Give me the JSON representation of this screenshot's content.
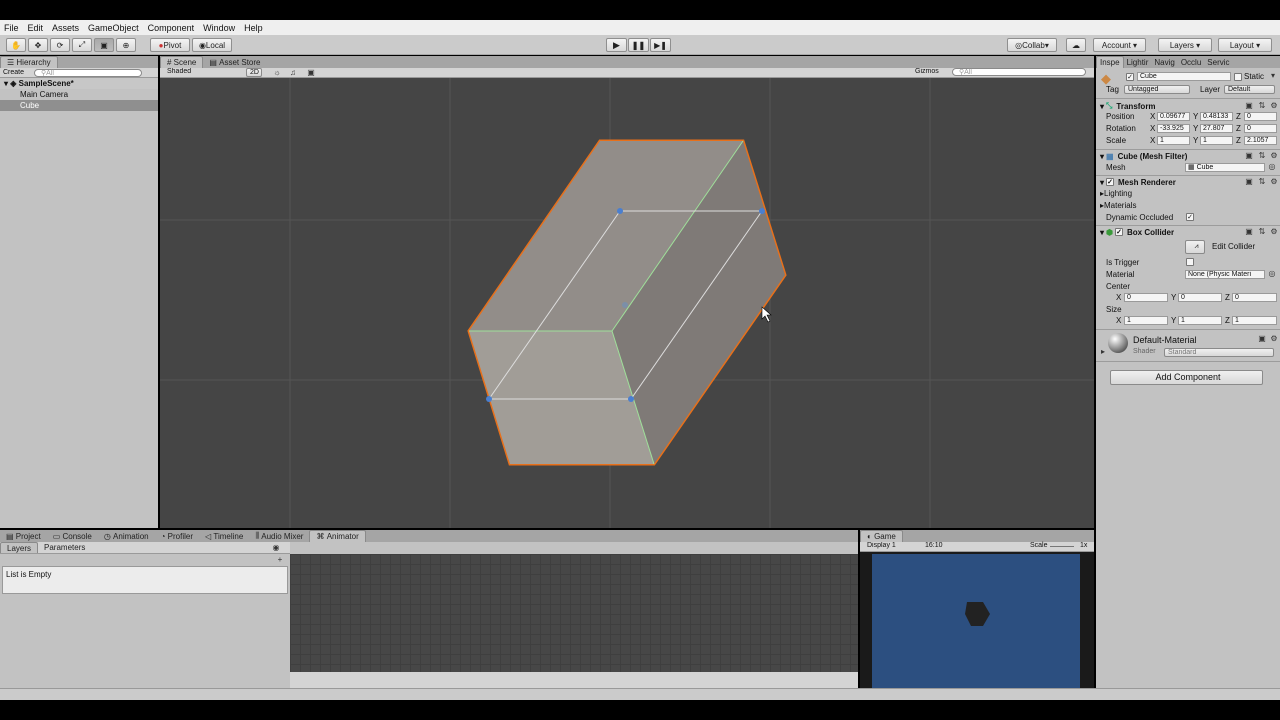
{
  "menu": [
    "File",
    "Edit",
    "Assets",
    "GameObject",
    "Component",
    "Window",
    "Help"
  ],
  "toolbar": {
    "pivot": "Pivot",
    "local": "Local",
    "collab": "Collab",
    "account": "Account",
    "layers": "Layers",
    "layout": "Layout"
  },
  "hierarchy": {
    "tab": "Hierarchy",
    "create": "Create",
    "search_placeholder": "All",
    "scene": "SampleScene*",
    "items": [
      "Main Camera",
      "Cube"
    ]
  },
  "scene": {
    "tab": "Scene",
    "asset_store_tab": "Asset Store",
    "shading": "Shaded",
    "mode2d": "2D",
    "gizmos": "Gizmos",
    "search_placeholder": "All"
  },
  "inspector": {
    "tabs": [
      "Inspe",
      "Lightir",
      "Navig",
      "Occlu",
      "Servic"
    ],
    "object_name": "Cube",
    "static_label": "Static",
    "tag_label": "Tag",
    "tag_value": "Untagged",
    "layer_label": "Layer",
    "layer_value": "Default",
    "transform": {
      "title": "Transform",
      "position_label": "Position",
      "rotation_label": "Rotation",
      "scale_label": "Scale",
      "position": [
        "0.09677",
        "0.48133",
        "0"
      ],
      "rotation": [
        "-33.925",
        "27.807",
        "0"
      ],
      "scale": [
        "1",
        "1",
        "2.1057"
      ]
    },
    "mesh_filter": {
      "title": "Cube (Mesh Filter)",
      "mesh_label": "Mesh",
      "mesh_value": "Cube"
    },
    "mesh_renderer": {
      "title": "Mesh Renderer",
      "lighting": "Lighting",
      "materials": "Materials",
      "dynamic_occluded": "Dynamic Occluded"
    },
    "box_collider": {
      "title": "Box Collider",
      "edit_collider": "Edit Collider",
      "is_trigger": "Is Trigger",
      "material_label": "Material",
      "material_value": "None (Physic Materi",
      "center_label": "Center",
      "center": [
        "0",
        "0",
        "0"
      ],
      "size_label": "Size",
      "size": [
        "1",
        "1",
        "1"
      ]
    },
    "material": {
      "name": "Default-Material",
      "shader_label": "Shader",
      "shader_value": "Standard"
    },
    "add_component": "Add Component",
    "axis": [
      "X",
      "Y",
      "Z"
    ]
  },
  "bottom": {
    "tabs": [
      "Project",
      "Console",
      "Animation",
      "Profiler",
      "Timeline",
      "Audio Mixer",
      "Animator"
    ],
    "active_tab": "Animator",
    "subtabs": [
      "Layers",
      "Parameters"
    ],
    "list_empty": "List is Empty"
  },
  "game": {
    "tab": "Game",
    "display": "Display 1",
    "aspect": "16:10",
    "scale_label": "Scale",
    "scale_value": "1x",
    "background_color": "#2c4f80"
  },
  "colors": {
    "selection_outline": "#e8701a",
    "scene_bg": "#454545",
    "panel_bg": "#c2c2c2"
  }
}
